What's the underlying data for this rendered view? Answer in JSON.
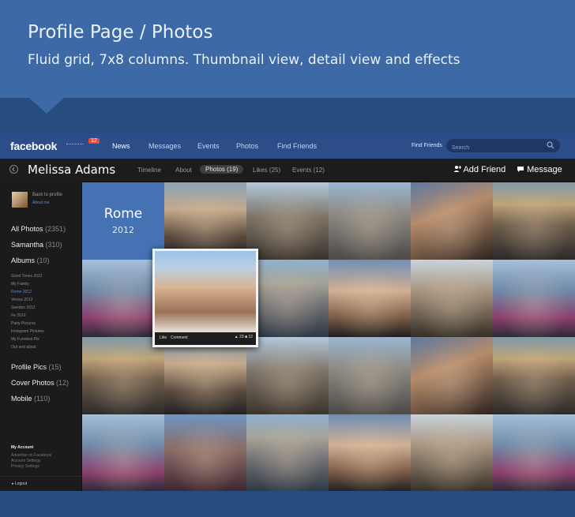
{
  "header": {
    "title": "Profile Page / Photos",
    "subtitle": "Fluid grid, 7x8 columns. Thumbnail view, detail view and effects"
  },
  "topbar": {
    "logo": "facebook",
    "notification_count": "12",
    "nav": [
      "News",
      "Messages",
      "Events",
      "Photos",
      "Find Friends"
    ],
    "active_nav": "News",
    "find_friends_label": "Find Friends",
    "search_placeholder": "Search"
  },
  "profile": {
    "name": "Melissa Adams",
    "tabs": [
      "Timeline",
      "About",
      "Photos (19)",
      "Likes (25)",
      "Events (12)"
    ],
    "active_tab": "Photos (19)",
    "add_friend": "Add Friend",
    "message": "Message"
  },
  "sidebar": {
    "back_to_profile": "Back to profile",
    "about_me": "About me",
    "items": [
      {
        "label": "All Photos",
        "count": "(2351)"
      },
      {
        "label": "Samantha",
        "count": "(310)"
      },
      {
        "label": "Albums",
        "count": "(10)"
      }
    ],
    "albums": [
      "Good Times 2012",
      "My Family",
      "Rome 2012",
      "Venice 2012",
      "Sweden 2012",
      "Fe 2010",
      "Party Pictures",
      "Instagram Pictures",
      "My Funniest Pix",
      "Out and about"
    ],
    "active_album": "Rome 2012",
    "more": [
      {
        "label": "Profile Pics",
        "count": "(15)"
      },
      {
        "label": "Cover Photos",
        "count": "(12)"
      },
      {
        "label": "Mobile",
        "count": "(110)"
      }
    ],
    "account_title": "My Account",
    "account_links": [
      "Advertise on Facebook",
      "Account Settings",
      "Privacy Settings"
    ],
    "logout": "Logout"
  },
  "album": {
    "title": "Rome",
    "year": "2012"
  },
  "popup": {
    "like": "Like",
    "comment": "Comment",
    "likes": "23",
    "comments": "12"
  },
  "colors": {
    "facebook_blue": "#2d4d88",
    "accent": "#4472b3",
    "link": "#5b8bd1",
    "notification": "#e8493f"
  }
}
